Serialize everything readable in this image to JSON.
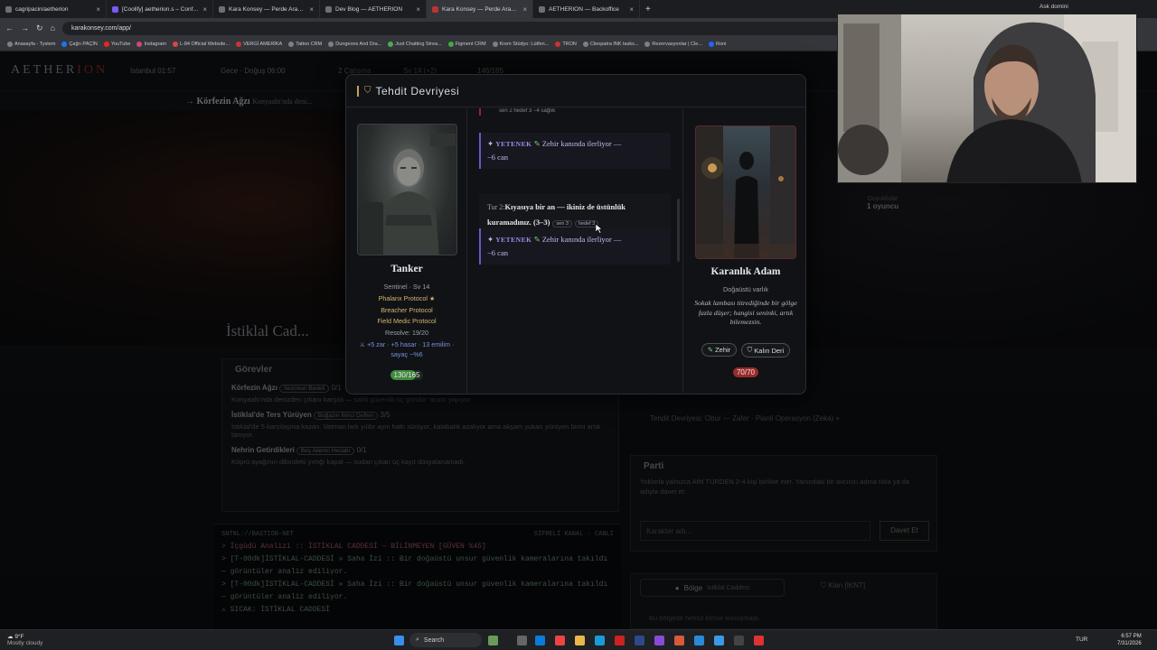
{
  "browser": {
    "tabs": [
      {
        "label": "cagripacin/aetherion",
        "active": false
      },
      {
        "label": "[Coolify] aetherion.s – Configu",
        "active": false
      },
      {
        "label": "Kara Konsey — Perde Arabirimi",
        "active": false
      },
      {
        "label": "Dev Blog — AETHERION",
        "active": false
      },
      {
        "label": "Kara Konsey — Perde Arabirimi",
        "active": true
      },
      {
        "label": "AETHERION — Backoffice",
        "active": false
      }
    ],
    "profile_label": "Ask domini",
    "url": "karakonsey.com/app/",
    "bookmarks": [
      "Anasayfa - Tystem",
      "Çağrı PAÇİN",
      "YouTube",
      "Instagram",
      "L-84 Official Website...",
      "VERGİ AMERİKA",
      "Tattoo CRM",
      "Dungeons And Dra...",
      "Just Chatting Strea...",
      "Figment CRM",
      "Krem Stüdyo: Lütfen...",
      "TRON",
      "Cleopatra INK tasks...",
      "Rezervasyonlar | Cle...",
      "Roni"
    ]
  },
  "app": {
    "logo_left": "AETHER",
    "logo_right": "ION",
    "topstats": [
      "İstanbul 01:57",
      "Gece · Doğuş 06:00",
      "2 Çatışma",
      "Sv 14 (+2)",
      "146/165"
    ],
    "location_prefix": "→",
    "location_name": "Körfezin Ağzı",
    "location_sub": "Konyaaltı'nda deni...",
    "street_title": "İstiklal Cad...",
    "gorevler": {
      "title": "Görevler",
      "quests": [
        {
          "name": "Körfezin Ağzı",
          "tag": "Sezonun Bedeli",
          "count": "0/1",
          "desc": "Konyaaltı'nda denizden çıkanı karşıla — sahil güvenlik üç gündür 'arıza' yapıyor"
        },
        {
          "name": "İstiklal'de Ters Yürüyen",
          "tag": "Boğazın İkinci Defteri",
          "count": "3/5",
          "desc": "İstiklal'de 5 karşılaşma kazan. Vatman lark yıldır aynı hattı sürüyor; kalabalık azalıyor ama akşam yukarı yürüyen birini artık tanıyor."
        },
        {
          "name": "Nehrin Getirdikleri",
          "tag": "Beş Ailenin Hesabı",
          "count": "0/1",
          "desc": "Köprü ayağının dibindeki yırtığı kapat — sudan çıkan üç kayıt dosyalanamadı."
        }
      ]
    },
    "terminal": {
      "title": "SNTNL://BASTION-NET",
      "right": "SİFRELİ KANAL · CANLI",
      "lines": [
        "> İçgüdü Analizi :: İSTİKLAL CADDESİ — BİLİNMEYEN [GÜVEN %45]",
        "> [T-00dk]İSTİKLAL-CADDESİ » Saha İzi :: Bir doğaüstü unsur güvenlik kameralarına takıldı — görüntüler analiz ediliyor.",
        "> [T-00dk]İSTİKLAL-CADDESİ » Saha İzi :: Bir doğaüstü unsur güvenlik kameralarına takıldı — görüntüler analiz ediliyor.",
        "⚠ SICAK: İSTİKLAL CADDESİ"
      ]
    },
    "right": {
      "oyuncu_label": "Duyuldular",
      "oyuncu_value": "1 oyuncu",
      "threat_line": "Tehdit Devriyesi: Obur — Zafer · Planli Operasyon (Zeka) +",
      "party_title": "Parti",
      "party_desc": "Yoklarla yalnızca Athl TÜRDEN 2-4 kişi birlikte iner. Yanındaki bir avcının adına tıkla ya da adıyla davet et:",
      "party_placeholder": "Karakter adı...",
      "invite_label": "Davet Et",
      "region_tab": "Bölge",
      "region_sub": "İstiklal Caddesi",
      "clan_tab": "Klan",
      "clan_sub": "[İKNT]",
      "region_empty": "Bu bölgede henüz kimse konuşmadı."
    }
  },
  "modal": {
    "title": "Tehdit Devriyesi",
    "player": {
      "name": "Tanker",
      "class_line": "Sentinel · Sv 14",
      "protocols": [
        "Phalanx Protocol ★",
        "Breacher Protocol",
        "Field Medic Protocol"
      ],
      "resolve": "Resolve: 19/20",
      "bonus": "⚔ +5 zar · +5 hasar · 13 emilim · sayaç ~%6",
      "hp": "130/165",
      "hp_fraction": 0.79
    },
    "log": {
      "top_fragment": "sen 2   hedef 3   −4 sağlık",
      "entries": [
        {
          "keyword": "YETENEK",
          "text": "Zehir kanında ilerliyor —",
          "dmg": "−6 can"
        },
        {
          "keyword": "YETENEK",
          "text": "Zehir kanında ilerliyor —",
          "dmg": "−6 can"
        }
      ],
      "turn_label": "Tur 2:",
      "turn_text": "Kıyasıya bir an — ikiniz de üstünlük kuramadınız. (3–3)",
      "chip_you": "sen 3",
      "chip_target": "hedef 3"
    },
    "enemy": {
      "name": "Karanlık Adam",
      "kind": "Doğaüstü varlık",
      "desc": "Sokak lambası titrediğinde bir gölge fazla düşer; hangisi seninki, artık bilemezsin.",
      "traits": [
        "Zehir",
        "Kalın Deri"
      ],
      "hp": "70/70",
      "hp_fraction": 1.0
    }
  },
  "taskbar": {
    "weather_temp": "9°F",
    "weather_desc": "Mostly cloudy",
    "search_label": "Search",
    "lang": "TUR",
    "time": "6:57 PM",
    "date": "7/31/2026"
  }
}
